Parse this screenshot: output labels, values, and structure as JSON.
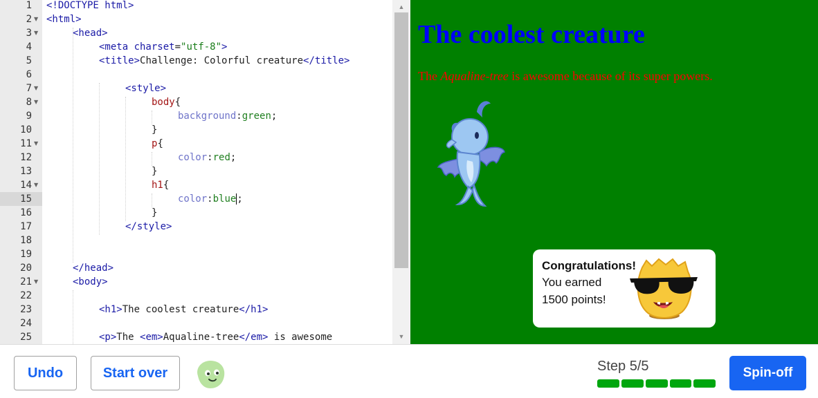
{
  "editor": {
    "line_numbers": [
      "1",
      "2",
      "3",
      "4",
      "5",
      "6",
      "7",
      "8",
      "9",
      "10",
      "11",
      "12",
      "13",
      "14",
      "15",
      "16",
      "17",
      "18",
      "19",
      "20",
      "21",
      "22",
      "23",
      "24",
      "25"
    ],
    "lines": {
      "l1": {
        "a": "<!DOCTYPE html>"
      },
      "l2": {
        "a": "<html>"
      },
      "l3": {
        "a": "<head>"
      },
      "l4": {
        "a": "<meta ",
        "b": "charset",
        "c": "=",
        "d": "\"utf-8\"",
        "e": ">"
      },
      "l5": {
        "a": "<title>",
        "b": "Challenge: Colorful creature",
        "c": "</title>"
      },
      "l7": {
        "a": "<style>"
      },
      "l8": {
        "a": "body",
        "b": "{"
      },
      "l9": {
        "a": "background",
        "b": ":",
        "c": "green",
        "d": ";"
      },
      "l10": {
        "a": "}"
      },
      "l11": {
        "a": "p",
        "b": "{"
      },
      "l12": {
        "a": "color",
        "b": ":",
        "c": "red",
        "d": ";"
      },
      "l13": {
        "a": "}"
      },
      "l14": {
        "a": "h1",
        "b": "{"
      },
      "l15": {
        "a": "color",
        "b": ":",
        "c": "blue",
        "d": ";"
      },
      "l16": {
        "a": "}"
      },
      "l17": {
        "a": "</style>"
      },
      "l20": {
        "a": "</head>"
      },
      "l21": {
        "a": "<body>"
      },
      "l23": {
        "a": "<h1>",
        "b": "The coolest creature",
        "c": "</h1>"
      },
      "l25": {
        "a": "<p>",
        "b": "The ",
        "c": "<em>",
        "d": "Aqualine-tree",
        "e": "</em>",
        "f": " is awesome"
      }
    }
  },
  "preview": {
    "heading": "The coolest creature",
    "para_before": "The ",
    "para_em": "Aqualine-tree",
    "para_after": " is awesome because of its super powers.",
    "colors": {
      "background": "#008000",
      "heading": "#0000ff",
      "paragraph": "#ff0000"
    }
  },
  "toast": {
    "title": "Congratulations!",
    "line1": "You earned",
    "line2": "1500 points!",
    "avatar_icon": "sunglasses-blob-avatar"
  },
  "bottom": {
    "undo_label": "Undo",
    "start_over_label": "Start over",
    "avatar_icon": "green-blob-avatar",
    "step_label": "Step 5/5",
    "progress": {
      "completed": 5,
      "total": 5
    },
    "spinoff_label": "Spin-off",
    "accent": "#1865f2",
    "progress_color": "#00a60e"
  }
}
